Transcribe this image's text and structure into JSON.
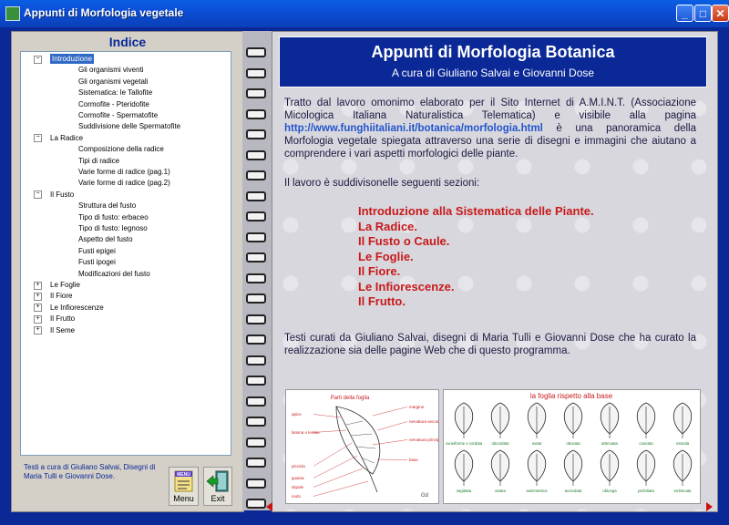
{
  "window": {
    "title": "Appunti di Morfologia vegetale"
  },
  "index": {
    "title": "Indice",
    "tree": [
      {
        "label": "Introduzione",
        "level": 0,
        "expanded": true,
        "selected": true
      },
      {
        "label": "Gli organismi viventi",
        "level": 1
      },
      {
        "label": "Gli organismi vegetali",
        "level": 1
      },
      {
        "label": "Sistematica: le Tallofite",
        "level": 1
      },
      {
        "label": "Cormofite - Pteridofite",
        "level": 1
      },
      {
        "label": "Cormofite - Spermatofite",
        "level": 1
      },
      {
        "label": "Suddivisione delle Spermatofite",
        "level": 1
      },
      {
        "label": "La Radice",
        "level": 0,
        "expanded": true
      },
      {
        "label": "Composizione della radice",
        "level": 1
      },
      {
        "label": "Tipi di radice",
        "level": 1
      },
      {
        "label": "Varie forme di radice (pag.1)",
        "level": 1
      },
      {
        "label": "Varie forme di radice (pag.2)",
        "level": 1
      },
      {
        "label": "Il Fusto",
        "level": 0,
        "expanded": true
      },
      {
        "label": "Struttura del fusto",
        "level": 1
      },
      {
        "label": "Tipo di fusto: erbaceo",
        "level": 1
      },
      {
        "label": "Tipo di fusto: legnoso",
        "level": 1
      },
      {
        "label": "Aspetto del fusto",
        "level": 1
      },
      {
        "label": "Fusti epigei",
        "level": 1
      },
      {
        "label": "Fusti ipogei",
        "level": 1
      },
      {
        "label": "Modificazioni del fusto",
        "level": 1
      },
      {
        "label": "Le Foglie",
        "level": 0,
        "expanded": false
      },
      {
        "label": "Il Fiore",
        "level": 0,
        "expanded": false
      },
      {
        "label": "Le Infiorescenze",
        "level": 0,
        "expanded": false
      },
      {
        "label": "Il Frutto",
        "level": 0,
        "expanded": false
      },
      {
        "label": "Il Seme",
        "level": 0,
        "expanded": false
      }
    ],
    "credits": "Testi a cura di Giuliano Salvai, Disegni di Maria Tulli e Giovanni Dose.",
    "menu_label": "Menu",
    "menu_icon_text": "MENU",
    "exit_label": "Exit"
  },
  "content": {
    "title": "Appunti di Morfologia Botanica",
    "subtitle": "A cura di Giuliano Salvai e Giovanni Dose",
    "intro_before_link": "Tratto dal lavoro omonimo elaborato per il Sito Internet di A.M.I.N.T. (Associazione Micologica Italiana Naturalistica Telematica) e visibile alla pagina ",
    "link": "http://www.funghiitaliani.it/botanica/morfologia.html",
    "intro_after_link": "  è una panoramica della Morfologia vegetale spiegata attraverso una serie di disegni e immagini che aiutano a comprendere i vari aspetti morfologici delle piante.",
    "sections_intro": "Il lavoro è suddivisonelle seguenti  sezioni:",
    "sections": [
      "Introduzione alla Sistematica delle Piante.",
      "La Radice.",
      "Il Fusto o Caule.",
      "Le Foglie.",
      "Il Fiore.",
      "Le Infiorescenze.",
      "Il Frutto."
    ],
    "closing": "Testi curati da Giuliano Salvai, disegni di Maria Tulli e Giovanni Dose che ha curato la realizzazione sia delle pagine Web che di questo programma."
  },
  "illustration_left": {
    "title": "Parti della foglia",
    "labels_left": [
      "apice",
      "lamina o lembo",
      "picciolo",
      "guaina",
      "stipole",
      "nodo"
    ],
    "labels_right": [
      "margine",
      "nervatura secondaria",
      "nervatura principale o mediana",
      "base"
    ]
  },
  "illustration_right": {
    "title": "la foglia rispetto alla base",
    "row1": [
      "cuneiforme o cordata",
      "obcordata",
      "ovata",
      "obovata",
      "attenuata",
      "cuneata",
      "rotonda"
    ],
    "row2": [
      "sagittata",
      "astata",
      "asimmetrica",
      "auriculata",
      "oblunga",
      "perfoliata",
      "embricata"
    ]
  },
  "colors": {
    "frame": "#0a2896",
    "header": "#0a2896",
    "sections": "#c81a1a",
    "link": "#2255cc",
    "arrow": "#cc1111"
  }
}
